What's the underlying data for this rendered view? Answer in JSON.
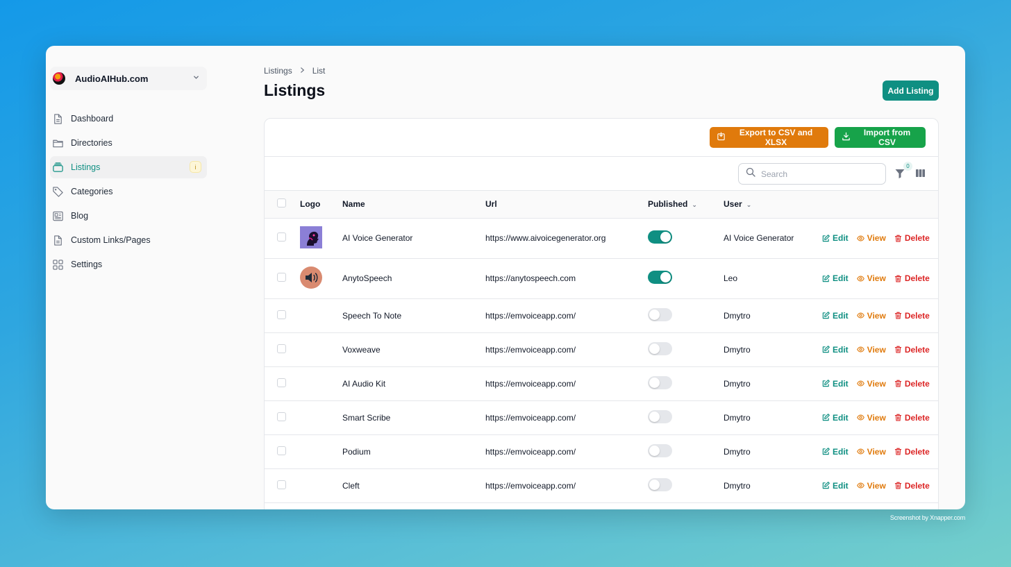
{
  "sidebar": {
    "site_name": "AudioAIHub.com",
    "items": [
      {
        "label": "Dashboard",
        "icon": "document-icon"
      },
      {
        "label": "Directories",
        "icon": "folder-icon"
      },
      {
        "label": "Listings",
        "icon": "stack-icon",
        "active": true,
        "badge": "i"
      },
      {
        "label": "Categories",
        "icon": "tag-icon"
      },
      {
        "label": "Blog",
        "icon": "newspaper-icon"
      },
      {
        "label": "Custom Links/Pages",
        "icon": "document-icon"
      },
      {
        "label": "Settings",
        "icon": "grid-icon"
      }
    ]
  },
  "breadcrumb": {
    "first": "Listings",
    "separator": ">",
    "second": "List"
  },
  "page": {
    "title": "Listings",
    "add_button": "Add Listing"
  },
  "actions": {
    "export": "Export to CSV and XLSX",
    "import": "Import from CSV"
  },
  "toolbar": {
    "search_placeholder": "Search",
    "filter_count": "0"
  },
  "table": {
    "headers": {
      "logo": "Logo",
      "name": "Name",
      "url": "Url",
      "published": "Published",
      "user": "User"
    },
    "row_actions": {
      "edit": "Edit",
      "view": "View",
      "delete": "Delete"
    },
    "rows": [
      {
        "logo": "ai-voice-generator-logo",
        "name": "AI Voice Generator",
        "url": "https://www.aivoicegenerator.org",
        "published": true,
        "user": "AI Voice Generator"
      },
      {
        "logo": "speaker-logo",
        "name": "AnytoSpeech",
        "url": "https://anytospeech.com",
        "published": true,
        "user": "Leo"
      },
      {
        "logo": "",
        "name": "Speech To Note",
        "url": "https://emvoiceapp.com/",
        "published": false,
        "user": "Dmytro"
      },
      {
        "logo": "",
        "name": "Voxweave",
        "url": "https://emvoiceapp.com/",
        "published": false,
        "user": "Dmytro"
      },
      {
        "logo": "",
        "name": "AI Audio Kit",
        "url": "https://emvoiceapp.com/",
        "published": false,
        "user": "Dmytro"
      },
      {
        "logo": "",
        "name": "Smart Scribe",
        "url": "https://emvoiceapp.com/",
        "published": false,
        "user": "Dmytro"
      },
      {
        "logo": "",
        "name": "Podium",
        "url": "https://emvoiceapp.com/",
        "published": false,
        "user": "Dmytro"
      },
      {
        "logo": "",
        "name": "Cleft",
        "url": "https://emvoiceapp.com/",
        "published": false,
        "user": "Dmytro"
      }
    ]
  },
  "watermark": "Screenshot by Xnapper.com",
  "colors": {
    "accent": "#0f8f82",
    "export": "#e07a0c",
    "import": "#17a34a",
    "delete": "#dc2626"
  }
}
